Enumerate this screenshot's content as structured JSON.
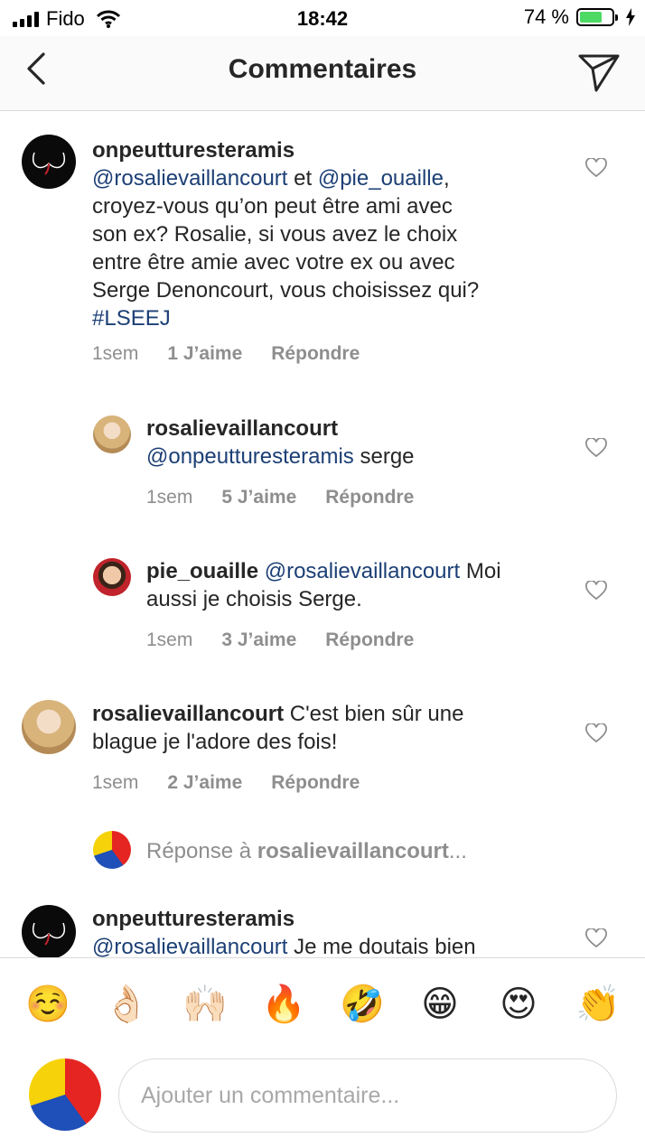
{
  "status_bar": {
    "carrier": "Fido",
    "time": "18:42",
    "battery_label": "74 %",
    "battery_level": 0.74,
    "battery_color": "#4cd964"
  },
  "header": {
    "title": "Commentaires",
    "back_icon": "chevron-left-icon",
    "send_icon": "paper-plane-icon"
  },
  "comments": [
    {
      "username": "onpeutturesteramis",
      "m1": "@rosalievaillancourt",
      "t1": " et ",
      "m2": "@pie_ouaille",
      "t2": ",",
      "line2": "croyez-vous qu’on peut être ami avec",
      "line3": "son ex? Rosalie, si vous avez le choix",
      "line4": "entre être amie avec votre ex ou avec",
      "line5": "Serge Denoncourt, vous choisissez qui?",
      "hashtag": "#LSEEJ",
      "time": "1sem",
      "likes": "1 J’aime",
      "reply": "Répondre"
    },
    {
      "username": "rosalievaillancourt",
      "mention": "@onpeutturesteramis",
      "text": " serge",
      "time": "1sem",
      "likes": "5 J’aime",
      "reply": "Répondre"
    },
    {
      "username": "pie_ouaille",
      "mention": "@rosalievaillancourt",
      "text": " Moi",
      "line2": "aussi je choisis Serge.",
      "time": "1sem",
      "likes": "3 J’aime",
      "reply": "Répondre"
    },
    {
      "username": "rosalievaillancourt",
      "text": " C'est bien sûr une",
      "line2": "blague je l'adore des fois!",
      "time": "1sem",
      "likes": "2 J’aime",
      "reply": "Répondre"
    },
    {
      "username": "onpeutturesteramis",
      "mention": "@rosalievaillancourt",
      "text": " Je me doutais bien"
    }
  ],
  "reply_prompt": {
    "prefix": "Réponse à ",
    "username": "rosalievaillancourt",
    "suffix": "..."
  },
  "emoji_bar": [
    "☺️",
    "👌🏻",
    "🙌🏻",
    "🔥",
    "🤣",
    "😁",
    "😍",
    "👏"
  ],
  "composer": {
    "placeholder": "Ajouter un commentaire..."
  }
}
